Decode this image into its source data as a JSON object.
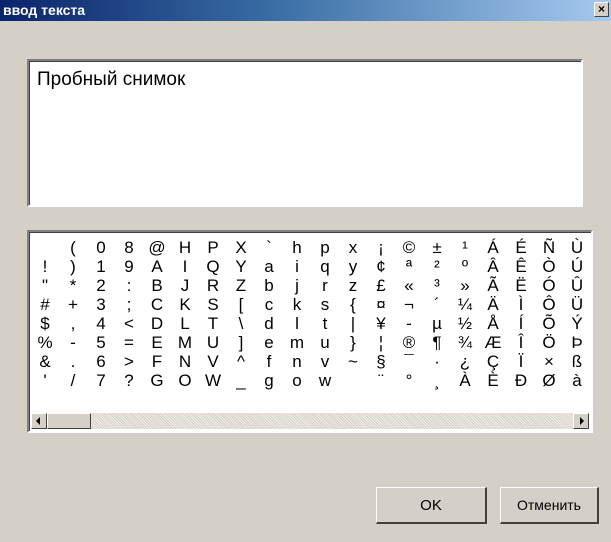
{
  "window": {
    "title": "ввод текста",
    "close_label": "×"
  },
  "text_input": {
    "value": "Пробный снимок"
  },
  "charmap": {
    "rows": [
      [
        " ",
        "(",
        "0",
        "8",
        "@",
        "H",
        "P",
        "X",
        "`",
        "h",
        "p",
        "x",
        "¡",
        "©",
        "±",
        "¹",
        "Á",
        "É",
        "Ñ",
        "Ù"
      ],
      [
        "!",
        ")",
        "1",
        "9",
        "A",
        "I",
        "Q",
        "Y",
        "a",
        "i",
        "q",
        "y",
        "¢",
        "ª",
        "²",
        "º",
        "Â",
        "Ê",
        "Ò",
        "Ú"
      ],
      [
        "\"",
        "*",
        "2",
        ":",
        "B",
        "J",
        "R",
        "Z",
        "b",
        "j",
        "r",
        "z",
        "£",
        "«",
        "³",
        "»",
        "Ã",
        "Ë",
        "Ó",
        "Û"
      ],
      [
        "#",
        "+",
        "3",
        ";",
        "C",
        "K",
        "S",
        "[",
        "c",
        "k",
        "s",
        "{",
        "¤",
        "¬",
        "´",
        "¼",
        "Ä",
        "Ì",
        "Ô",
        "Ü"
      ],
      [
        "$",
        ",",
        "4",
        "<",
        "D",
        "L",
        "T",
        "\\",
        "d",
        "l",
        "t",
        "|",
        "¥",
        "-",
        "µ",
        "½",
        "Å",
        "Í",
        "Õ",
        "Ý"
      ],
      [
        "%",
        "-",
        "5",
        "=",
        "E",
        "M",
        "U",
        "]",
        "e",
        "m",
        "u",
        "}",
        "¦",
        "®",
        "¶",
        "¾",
        "Æ",
        "Î",
        "Ö",
        "Þ"
      ],
      [
        "&",
        ".",
        "6",
        ">",
        "F",
        "N",
        "V",
        "^",
        "f",
        "n",
        "v",
        "~",
        "§",
        "¯",
        "·",
        "¿",
        "Ç",
        "Ï",
        "×",
        "ß"
      ],
      [
        "'",
        "/",
        "7",
        "?",
        "G",
        "O",
        "W",
        "_",
        "g",
        "o",
        "w",
        "",
        "¨",
        "°",
        "¸",
        "À",
        "È",
        "Ð",
        "Ø",
        "à"
      ]
    ]
  },
  "buttons": {
    "ok_label": "OK",
    "cancel_label": "Отменить"
  },
  "colors": {
    "titlebar_start": "#0a246a",
    "titlebar_end": "#a6caf0",
    "face": "#d4d0c8"
  }
}
